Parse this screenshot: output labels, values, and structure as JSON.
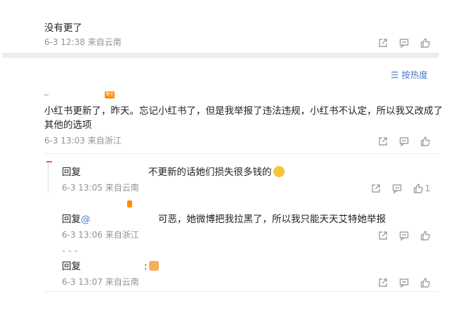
{
  "top_comment": {
    "text": "没有更了",
    "meta": "6-3 12:38 来自云南"
  },
  "sort": {
    "label": "按热度",
    "icon": "sort-icon"
  },
  "main_comment": {
    "badge": "博主",
    "line1": "小红书更新了，昨天。忘记小红书了，但是我举报了违法违规，小红书不认定，所以我又改成了",
    "line2": "其他的选项",
    "meta": "6-3 13:03 来自浙江"
  },
  "replies": [
    {
      "prefix": "回复",
      "text": "不更新的话她们损失很多钱的",
      "emoji": "laughing-crying-emoji",
      "meta": "6-3 13:05 来自云南",
      "like_count": "1"
    },
    {
      "prefix": "回复",
      "at": "@",
      "text": "可恶，她微博把我拉黑了，所以我只能天天艾特她举报",
      "meta": "6-3 13:06 来自浙江"
    },
    {
      "prefix": "回复",
      "text": ":",
      "emoji": "thumbs-up-emoji",
      "meta": "6-3 13:07 来自云南",
      "dots": "- - -"
    }
  ],
  "icons": {
    "share": "share-icon",
    "comment": "comment-icon",
    "like": "like-icon"
  },
  "colors": {
    "link": "#4b7bd0",
    "meta": "#939393",
    "badge": "#ff8a00"
  }
}
